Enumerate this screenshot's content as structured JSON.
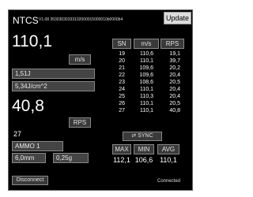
{
  "app": {
    "title": "NTCS",
    "version_line": "V1.08 35303030333102000015000010b0000b4",
    "tab": "Update"
  },
  "velocity": {
    "value": "110,1",
    "unit": "m/s"
  },
  "weight_field": "1,51J",
  "energy_field": "5,34J/cm^2",
  "rps": {
    "value": "40,8",
    "unit": "RPS"
  },
  "shot_count": "27",
  "ammo": {
    "label": "AMMO 1",
    "caliber": "6,0mm",
    "weight": "0,25g"
  },
  "disconnect_label": "Disconnect",
  "table": {
    "headers": [
      "SN",
      "m/s",
      "RPS"
    ],
    "rows": [
      [
        "19",
        "110,6",
        "19,1"
      ],
      [
        "20",
        "110,1",
        "39,7"
      ],
      [
        "21",
        "109,6",
        "20,2"
      ],
      [
        "22",
        "109,6",
        "20,4"
      ],
      [
        "23",
        "108,6",
        "20,5"
      ],
      [
        "24",
        "110,1",
        "20,4"
      ],
      [
        "25",
        "110,3",
        "20,4"
      ],
      [
        "26",
        "110,1",
        "20,5"
      ],
      [
        "27",
        "110,1",
        "40,8"
      ]
    ]
  },
  "sync_label": "SYNC",
  "stats": {
    "labels": [
      "MAX",
      "MIN",
      "AVG"
    ],
    "values": [
      "112,1",
      "106,6",
      "110,1"
    ]
  },
  "status": "Connected"
}
